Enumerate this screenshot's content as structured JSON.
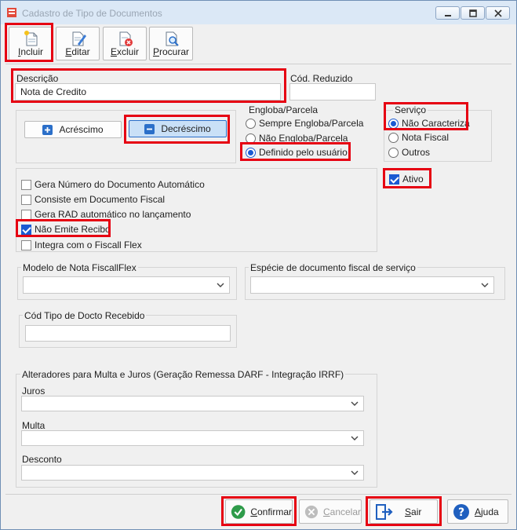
{
  "window": {
    "title": "Cadastro de Tipo de Documentos"
  },
  "toolbar": {
    "incluir": "Incluir",
    "editar": "Editar",
    "excluir": "Excluir",
    "procurar": "Procurar"
  },
  "form": {
    "descricao_label": "Descrição",
    "descricao_value": "Nota de Credito",
    "cod_reduzido_label": "Cód. Reduzido",
    "cod_reduzido_value": ""
  },
  "operation": {
    "acrescimo": "Acréscimo",
    "decrescimo": "Decréscimo",
    "selected": "Decréscimo"
  },
  "engloba": {
    "title": "Engloba/Parcela",
    "options": [
      "Sempre Engloba/Parcela",
      "Não Engloba/Parcela",
      "Definido pelo usuário"
    ],
    "selected": "Definido pelo usuário"
  },
  "servico": {
    "title": "Serviço",
    "options": [
      "Não Caracteriza",
      "Nota Fiscal",
      "Outros"
    ],
    "selected": "Não Caracteriza"
  },
  "ativo": {
    "label": "Ativo",
    "checked": true
  },
  "checks": [
    {
      "label": "Gera Número do Documento Automático",
      "checked": false
    },
    {
      "label": "Consiste em Documento Fiscal",
      "checked": false
    },
    {
      "label": "Gera RAD automático no lançamento",
      "checked": false
    },
    {
      "label": "Não Emite Recibo",
      "checked": true
    },
    {
      "label": "Integra com o Fiscall Flex",
      "checked": false
    }
  ],
  "modelo": {
    "label": "Modelo de Nota FiscallFlex",
    "value": ""
  },
  "especie": {
    "label": "Espécie de documento fiscal de serviço",
    "value": ""
  },
  "cod_tipo": {
    "label": "Cód Tipo de Docto Recebido",
    "value": ""
  },
  "alteradores": {
    "title": "Alteradores para Multa e Juros (Geração Remessa DARF - Integração IRRF)",
    "juros": "Juros",
    "multa": "Multa",
    "desconto": "Desconto"
  },
  "footer": {
    "confirmar": "Confirmar",
    "cancelar": "Cancelar",
    "sair": "Sair",
    "ajuda": "Ajuda"
  },
  "colors": {
    "highlight": "#e60012",
    "accent": "#1a5ad2",
    "confirm_green": "#2e9b4a",
    "help_blue": "#1f5fbf"
  },
  "icons": [
    "new-document-icon",
    "edit-document-icon",
    "delete-document-icon",
    "search-document-icon",
    "plus-icon",
    "minus-icon",
    "check-circle-icon",
    "cancel-circle-icon",
    "exit-door-icon",
    "help-icon"
  ]
}
